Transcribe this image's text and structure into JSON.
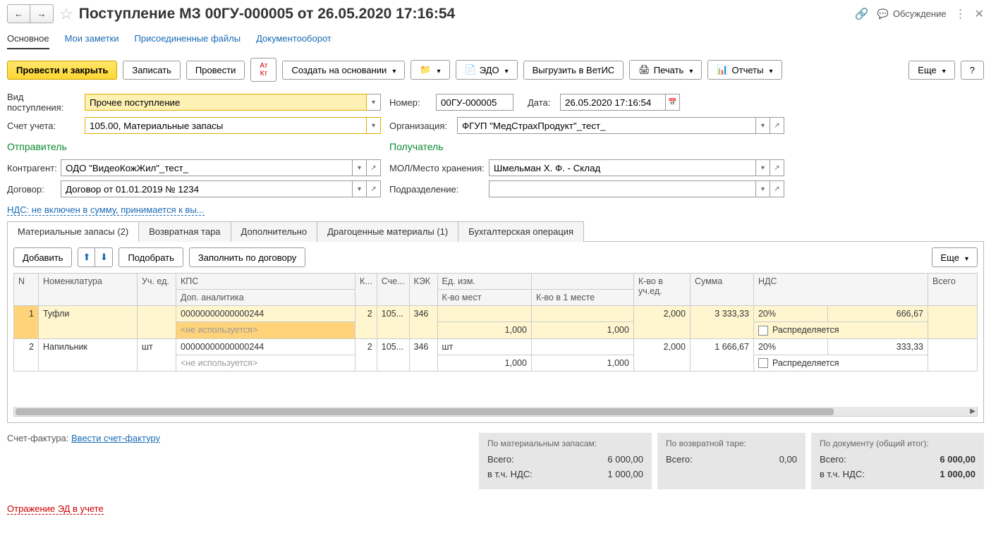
{
  "header": {
    "title": "Поступление МЗ 00ГУ-000005 от 26.05.2020 17:16:54",
    "discuss": "Обсуждение"
  },
  "nav": {
    "main": "Основное",
    "notes": "Мои заметки",
    "files": "Присоединенные файлы",
    "docflow": "Документооборот"
  },
  "toolbar": {
    "post_close": "Провести и закрыть",
    "save": "Записать",
    "post": "Провести",
    "create_based": "Создать на основании",
    "edo": "ЭДО",
    "vetis": "Выгрузить в ВетИС",
    "print": "Печать",
    "reports": "Отчеты",
    "more": "Еще",
    "help": "?"
  },
  "form": {
    "type_label": "Вид поступления:",
    "type_value": "Прочее поступление",
    "number_label": "Номер:",
    "number_value": "00ГУ-000005",
    "date_label": "Дата:",
    "date_value": "26.05.2020 17:16:54",
    "account_label": "Счет учета:",
    "account_value": "105.00, Материальные запасы",
    "org_label": "Организация:",
    "org_value": "ФГУП \"МедСтрахПродукт\"_тест_",
    "sender_title": "Отправитель",
    "receiver_title": "Получатель",
    "contragent_label": "Контрагент:",
    "contragent_value": "ОДО \"ВидеоКожЖил\"_тест_",
    "mol_label": "МОЛ/Место хранения:",
    "mol_value": "Шмельман Х. Ф. - Склад",
    "contract_label": "Договор:",
    "contract_value": "Договор от 01.01.2019 № 1234",
    "subdiv_label": "Подразделение:",
    "nds_link": "НДС: не включен в сумму, принимается к вы..."
  },
  "tabs": {
    "t1": "Материальные запасы (2)",
    "t2": "Возвратная тара",
    "t3": "Дополнительно",
    "t4": "Драгоценные материалы (1)",
    "t5": "Бухгалтерская операция"
  },
  "tbl_toolbar": {
    "add": "Добавить",
    "pick": "Подобрать",
    "fill": "Заполнить по договору",
    "more": "Еще"
  },
  "cols": {
    "n": "N",
    "nomen": "Номенклатура",
    "unit": "Уч. ед.",
    "kps": "КПС",
    "k": "К...",
    "acc": "Сче...",
    "kek": "КЭК",
    "meas": "Ед. изм.",
    "qty": "К-во в уч.ед.",
    "sum": "Сумма",
    "nds_col": "НДС",
    "total_col": "Всего",
    "dop": "Доп. аналитика",
    "mest": "К-во мест",
    "v1": "К-во в 1 месте"
  },
  "rows": [
    {
      "n": "1",
      "nomen": "Туфли",
      "unit": "",
      "kps": "00000000000000244",
      "k": "2",
      "acc": "105...",
      "kek": "346",
      "meas": "",
      "qty": "2,000",
      "sum": "3 333,33",
      "nds": "20%",
      "nds_sum": "666,67",
      "dop": "<не используется>",
      "mest": "1,000",
      "v1": "1,000",
      "dist": "Распределяется"
    },
    {
      "n": "2",
      "nomen": "Напильник",
      "unit": "шт",
      "kps": "00000000000000244",
      "k": "2",
      "acc": "105...",
      "kek": "346",
      "meas": "шт",
      "qty": "2,000",
      "sum": "1 666,67",
      "nds": "20%",
      "nds_sum": "333,33",
      "dop": "<не используется>",
      "mest": "1,000",
      "v1": "1,000",
      "dist": "Распределяется"
    }
  ],
  "footer": {
    "sf_label": "Счет-фактура:",
    "sf_link": "Ввести счет-фактуру",
    "box1_title": "По материальным запасам:",
    "box2_title": "По возвратной таре:",
    "box3_title": "По документу (общий итог):",
    "vsego": "Всего:",
    "vtch": "в т.ч. НДС:",
    "b1_total": "6 000,00",
    "b1_nds": "1 000,00",
    "b2_total": "0,00",
    "b3_total": "6 000,00",
    "b3_nds": "1 000,00",
    "bottom": "Отражение ЭД в учете"
  }
}
